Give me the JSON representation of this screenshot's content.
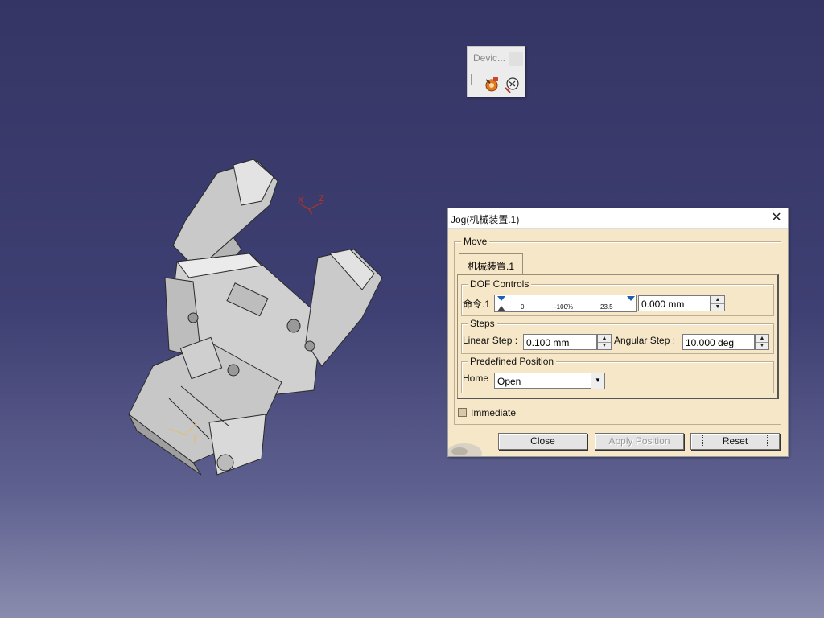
{
  "device_toolbar": {
    "title": "Devic...",
    "tools": [
      {
        "name": "jog-mechanism-icon",
        "color": "#d86a1a"
      },
      {
        "name": "device-settings-icon",
        "color": "#444444"
      }
    ]
  },
  "viewport": {
    "axis_labels": {
      "x": "X",
      "y": "y",
      "z": "Z"
    },
    "axis_color": "#c03020"
  },
  "jog_dialog": {
    "title": "Jog(机械装置.1)",
    "move_group": "Move",
    "tab_label": "机械装置.1",
    "dof_controls": {
      "legend": "DOF Controls",
      "command_label": "命令.1",
      "slider_ticks": [
        "0",
        "-100%",
        "23.5"
      ],
      "value": "0.000 mm"
    },
    "steps": {
      "legend": "Steps",
      "linear_label": "Linear Step :",
      "linear_value": "0.100 mm",
      "angular_label": "Angular Step :",
      "angular_value": "10.000 deg"
    },
    "predefined": {
      "legend": "Predefined Position",
      "home_label": "Home",
      "selected": "Open"
    },
    "immediate_label": "Immediate",
    "buttons": {
      "close": "Close",
      "apply": "Apply Position",
      "reset": "Reset"
    }
  }
}
